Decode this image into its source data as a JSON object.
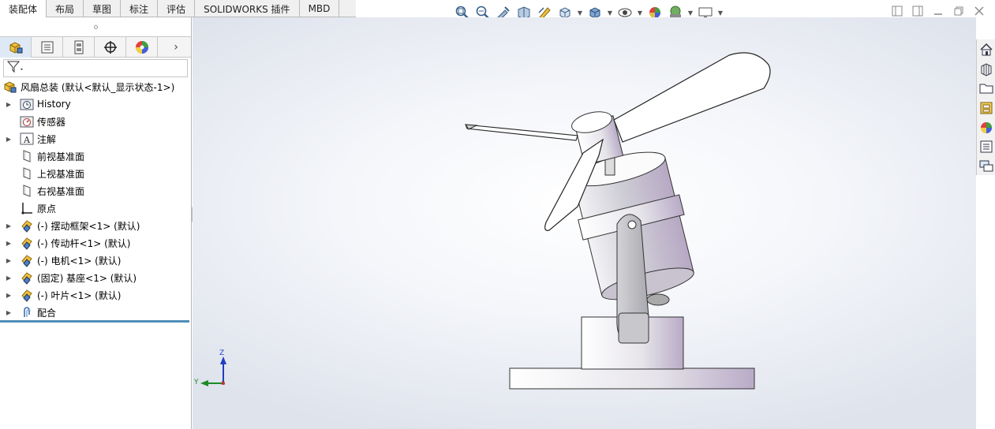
{
  "tabs": [
    {
      "label": "装配体",
      "active": true
    },
    {
      "label": "布局",
      "active": false
    },
    {
      "label": "草图",
      "active": false
    },
    {
      "label": "标注",
      "active": false
    },
    {
      "label": "评估",
      "active": false
    },
    {
      "label": "SOLIDWORKS 插件",
      "active": false
    },
    {
      "label": "MBD",
      "active": false
    }
  ],
  "hud_icons": [
    "zoom-to-fit-icon",
    "zoom-to-area-icon",
    "previous-view-icon",
    "section-view-icon",
    "dynamic-annotation-icon",
    "view-orientation-icon",
    "display-style-icon",
    "hide-show-icon",
    "edit-appearance-icon",
    "apply-scene-icon",
    "view-settings-icon"
  ],
  "feature_tree": {
    "root": "风扇总装 (默认<默认_显示状态-1>)",
    "items": [
      {
        "label": "History",
        "icon": "history-icon",
        "expandable": true
      },
      {
        "label": "传感器",
        "icon": "sensor-icon",
        "expandable": false
      },
      {
        "label": "注解",
        "icon": "annotation-icon",
        "expandable": true
      },
      {
        "label": "前视基准面",
        "icon": "plane-icon",
        "expandable": false
      },
      {
        "label": "上视基准面",
        "icon": "plane-icon",
        "expandable": false
      },
      {
        "label": "右视基准面",
        "icon": "plane-icon",
        "expandable": false
      },
      {
        "label": "原点",
        "icon": "origin-icon",
        "expandable": false
      },
      {
        "label": "(-) 摆动框架<1> (默认)",
        "icon": "part-icon",
        "expandable": true
      },
      {
        "label": "(-) 传动杆<1> (默认)",
        "icon": "part-icon",
        "expandable": true
      },
      {
        "label": "(-) 电机<1> (默认)",
        "icon": "part-icon",
        "expandable": true
      },
      {
        "label": "(固定) 基座<1> (默认)",
        "icon": "part-icon",
        "expandable": true
      },
      {
        "label": "(-) 叶片<1> (默认)",
        "icon": "part-icon",
        "expandable": true
      },
      {
        "label": "配合",
        "icon": "mates-icon",
        "expandable": true
      }
    ]
  },
  "triad": {
    "z": "Z",
    "y": "Y",
    "x": "X"
  },
  "colors": {
    "accent": "#4f8fb8",
    "part_yellow": "#e8b620",
    "part_blue": "#2f6fbf"
  }
}
